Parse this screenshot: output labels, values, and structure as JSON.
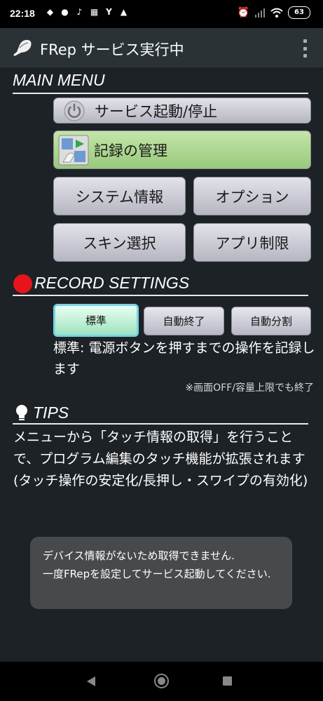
{
  "status_bar": {
    "time": "22:18",
    "battery": "63",
    "notification_icons": [
      "maps-icon",
      "line-icon",
      "tiktok-icon",
      "qr-icon",
      "yahoo-icon",
      "warning-icon"
    ],
    "status_icons": [
      "alarm-icon",
      "signal-icon",
      "wifi-icon"
    ]
  },
  "app_bar": {
    "title": "FRep サービス実行中"
  },
  "main_menu": {
    "title": "MAIN MENU",
    "service_button": "サービス起動/停止",
    "record_button": "記録の管理",
    "system_info_button": "システム情報",
    "options_button": "オプション",
    "skin_button": "スキン選択",
    "app_limit_button": "アプリ制限"
  },
  "record_settings": {
    "title": "RECORD SETTINGS",
    "modes": [
      "標準",
      "自動終了",
      "自動分割"
    ],
    "selected_mode": "標準",
    "description": "標準: 電源ボタンを押すまでの操作を記録します",
    "note": "※画面OFF/容量上限でも終了",
    "indicator_color": "#e8141c"
  },
  "tips": {
    "title": "TIPS",
    "text": "メニューから「タッチ情報の取得」を行うことで、プログラム編集のタッチ機能が拡張されます(タッチ操作の安定化/長押し・スワイプの有効化)"
  },
  "toast": {
    "line1": "デバイス情報がないため取得できません.",
    "line2": "一度FRepを設定してサービス起動してください."
  },
  "colors": {
    "background": "#1d2226",
    "app_bar": "#2b3236",
    "green_button": "#a8d48b",
    "selected_mode": "#b6efd0"
  }
}
